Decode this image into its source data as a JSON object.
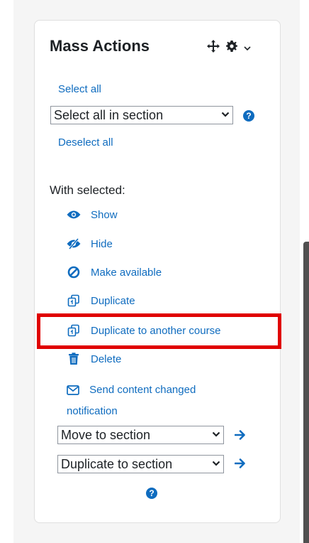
{
  "block": {
    "title": "Mass Actions"
  },
  "selection": {
    "select_all": "Select all",
    "select_in_section": "Select all in section",
    "deselect_all": "Deselect all"
  },
  "actions": {
    "heading": "With selected:",
    "items": [
      {
        "label": "Show",
        "icon": "eye-icon"
      },
      {
        "label": "Hide",
        "icon": "eye-slash-icon"
      },
      {
        "label": "Make available",
        "icon": "ban-icon"
      },
      {
        "label": "Duplicate",
        "icon": "copy-icon"
      },
      {
        "label": "Duplicate to another course",
        "icon": "copy-icon"
      },
      {
        "label": "Delete",
        "icon": "trash-icon"
      },
      {
        "label": "Send content changed notification",
        "icon": "envelope-icon"
      }
    ],
    "move_to_section": "Move to section",
    "duplicate_to_section": "Duplicate to section"
  },
  "colors": {
    "link": "#0f6cbf",
    "highlight": "#e00000",
    "text": "#1d2125"
  }
}
